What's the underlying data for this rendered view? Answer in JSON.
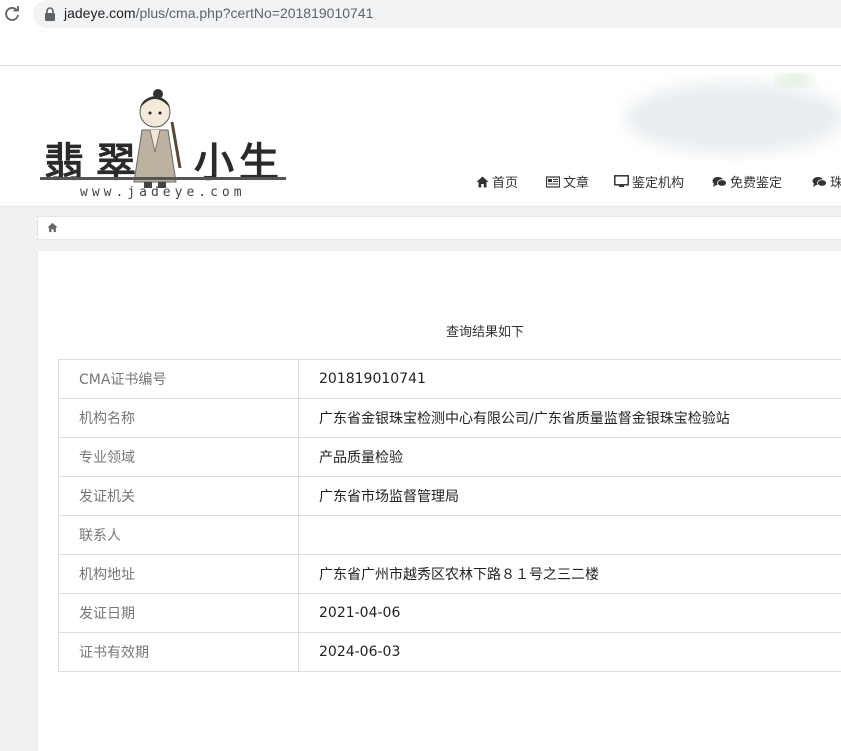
{
  "browser": {
    "url_domain": "jadeye.com",
    "url_rest": "/plus/cma.php?certNo=201819010741"
  },
  "logo": {
    "chars": [
      "翡",
      "翠",
      "小",
      "生"
    ],
    "domain": "www.jadeye.com"
  },
  "nav": {
    "items": [
      {
        "label": "首页",
        "icon": "home-icon"
      },
      {
        "label": "文章",
        "icon": "newspaper-icon"
      },
      {
        "label": "鉴定机构",
        "icon": "monitor-icon"
      },
      {
        "label": "免费鉴定",
        "icon": "comments-icon"
      },
      {
        "label": "珠",
        "icon": "comments-icon"
      }
    ]
  },
  "breadcrumb": {
    "icon": "home-icon"
  },
  "result": {
    "title": "查询结果如下",
    "rows": [
      {
        "label": "CMA证书编号",
        "value": "201819010741"
      },
      {
        "label": "机构名称",
        "value": "广东省金银珠宝检测中心有限公司/广东省质量监督金银珠宝检验站"
      },
      {
        "label": "专业领域",
        "value": "产品质量检验"
      },
      {
        "label": "发证机关",
        "value": "广东省市场监督管理局"
      },
      {
        "label": "联系人",
        "value": ""
      },
      {
        "label": "机构地址",
        "value": "广东省广州市越秀区农林下路８１号之三二楼"
      },
      {
        "label": "发证日期",
        "value": "2021-04-06"
      },
      {
        "label": "证书有效期",
        "value": "2024-06-03"
      }
    ]
  }
}
